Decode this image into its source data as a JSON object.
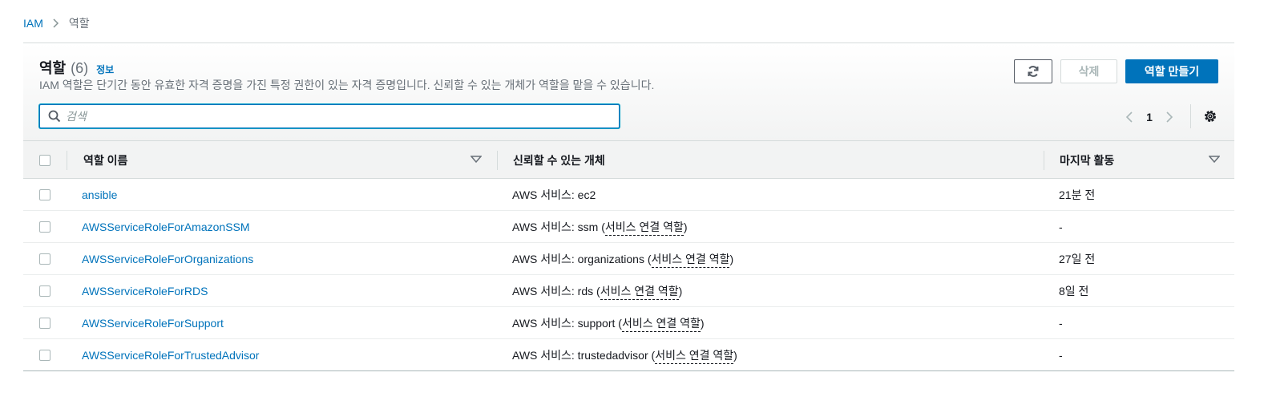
{
  "breadcrumb": {
    "root": "IAM",
    "current": "역할"
  },
  "header": {
    "title": "역할",
    "count": "(6)",
    "info": "정보",
    "description": "IAM 역할은 단기간 동안 유효한 자격 증명을 가진 특정 권한이 있는 자격 증명입니다. 신뢰할 수 있는 개체가 역할을 맡을 수 있습니다."
  },
  "actions": {
    "delete_label": "삭제",
    "create_label": "역할 만들기"
  },
  "search": {
    "placeholder": "검색",
    "value": ""
  },
  "pagination": {
    "current_page": "1"
  },
  "table": {
    "columns": [
      "역할 이름",
      "신뢰할 수 있는 개체",
      "마지막 활동"
    ],
    "rows": [
      {
        "name": "ansible",
        "trusted_prefix": "AWS 서비스: ec2",
        "linked": "",
        "last_activity": "21분 전"
      },
      {
        "name": "AWSServiceRoleForAmazonSSM",
        "trusted_prefix": "AWS 서비스: ssm",
        "linked": "서비스 연결 역할",
        "last_activity": "-"
      },
      {
        "name": "AWSServiceRoleForOrganizations",
        "trusted_prefix": "AWS 서비스: organizations",
        "linked": "서비스 연결 역할",
        "last_activity": "27일 전"
      },
      {
        "name": "AWSServiceRoleForRDS",
        "trusted_prefix": "AWS 서비스: rds",
        "linked": "서비스 연결 역할",
        "last_activity": "8일 전"
      },
      {
        "name": "AWSServiceRoleForSupport",
        "trusted_prefix": "AWS 서비스: support",
        "linked": "서비스 연결 역할",
        "last_activity": "-"
      },
      {
        "name": "AWSServiceRoleForTrustedAdvisor",
        "trusted_prefix": "AWS 서비스: trustedadvisor",
        "linked": "서비스 연결 역할",
        "last_activity": "-"
      }
    ]
  },
  "icons": {
    "refresh": "refresh-icon",
    "search": "search-icon",
    "settings": "gear-icon",
    "prev": "chevron-left-icon",
    "next": "chevron-right-icon",
    "sort": "caret-down-icon"
  },
  "colors": {
    "link": "#0073bb",
    "primary_button": "#0073bb",
    "header_bg": "#f2f3f3",
    "muted_text": "#687078"
  }
}
